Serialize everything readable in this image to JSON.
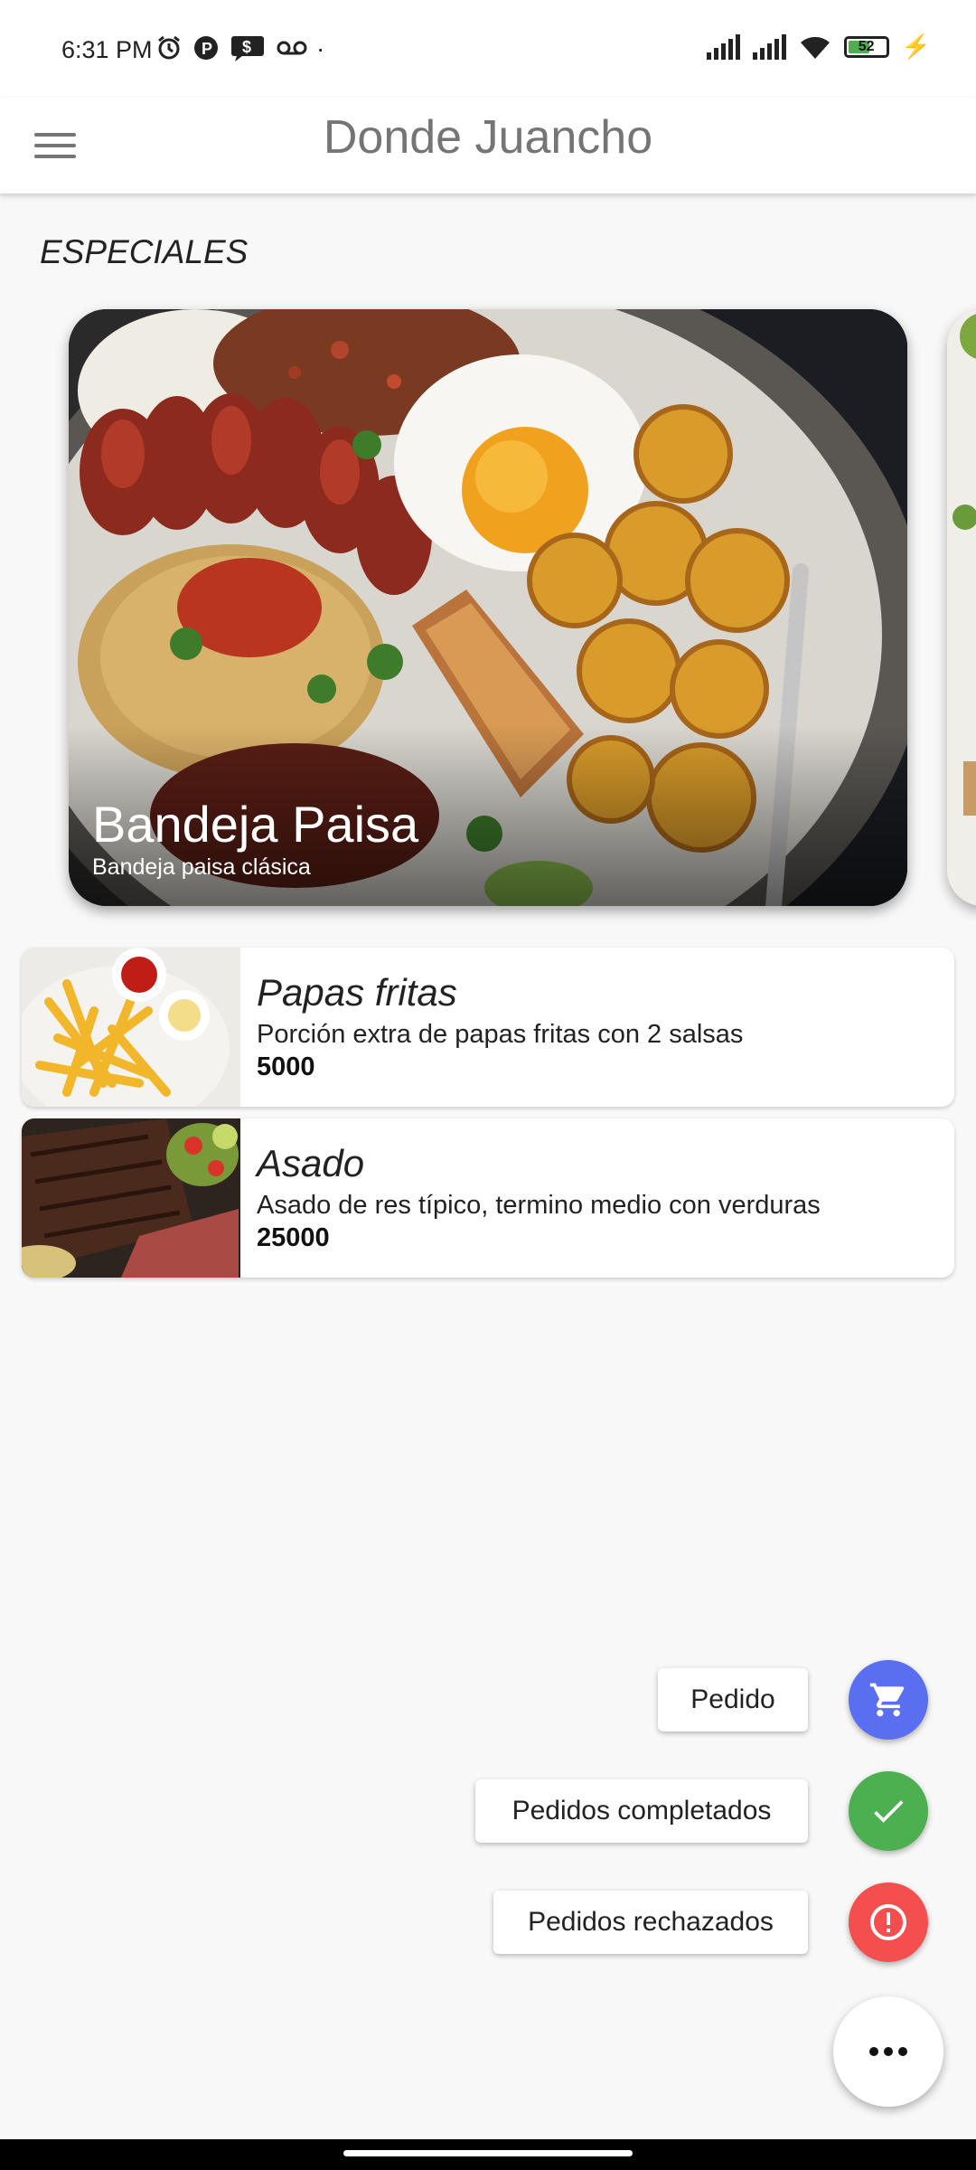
{
  "status_bar": {
    "time": "6:31 PM",
    "icons_left": [
      "alarm-icon",
      "p-icon",
      "message-icon",
      "voicemail-icon"
    ],
    "dot": "·",
    "battery_level": "52",
    "icons_right": [
      "signal-icon",
      "signal-icon",
      "wifi-icon",
      "battery-icon",
      "charging-icon"
    ]
  },
  "app_bar": {
    "title": "Donde Juancho",
    "menu_icon": "hamburger-menu-icon"
  },
  "specials": {
    "section_title": "ESPECIALES",
    "featured": {
      "name": "Bandeja Paisa",
      "description": "Bandeja paisa clásica"
    }
  },
  "menu_items": [
    {
      "name": "Papas fritas",
      "description": "Porción extra de papas fritas con 2 salsas",
      "price": "5000"
    },
    {
      "name": "Asado",
      "description": "Asado de res típico, termino medio con verduras",
      "price": "25000"
    }
  ],
  "speed_dial": {
    "actions": [
      {
        "label": "Pedido",
        "icon": "cart-icon",
        "color": "#5a6ef0"
      },
      {
        "label": "Pedidos completados",
        "icon": "check-icon",
        "color": "#4caf50"
      },
      {
        "label": "Pedidos rechazados",
        "icon": "error-icon",
        "color": "#f44e4e"
      }
    ],
    "main_icon": "more-horizontal-icon"
  }
}
